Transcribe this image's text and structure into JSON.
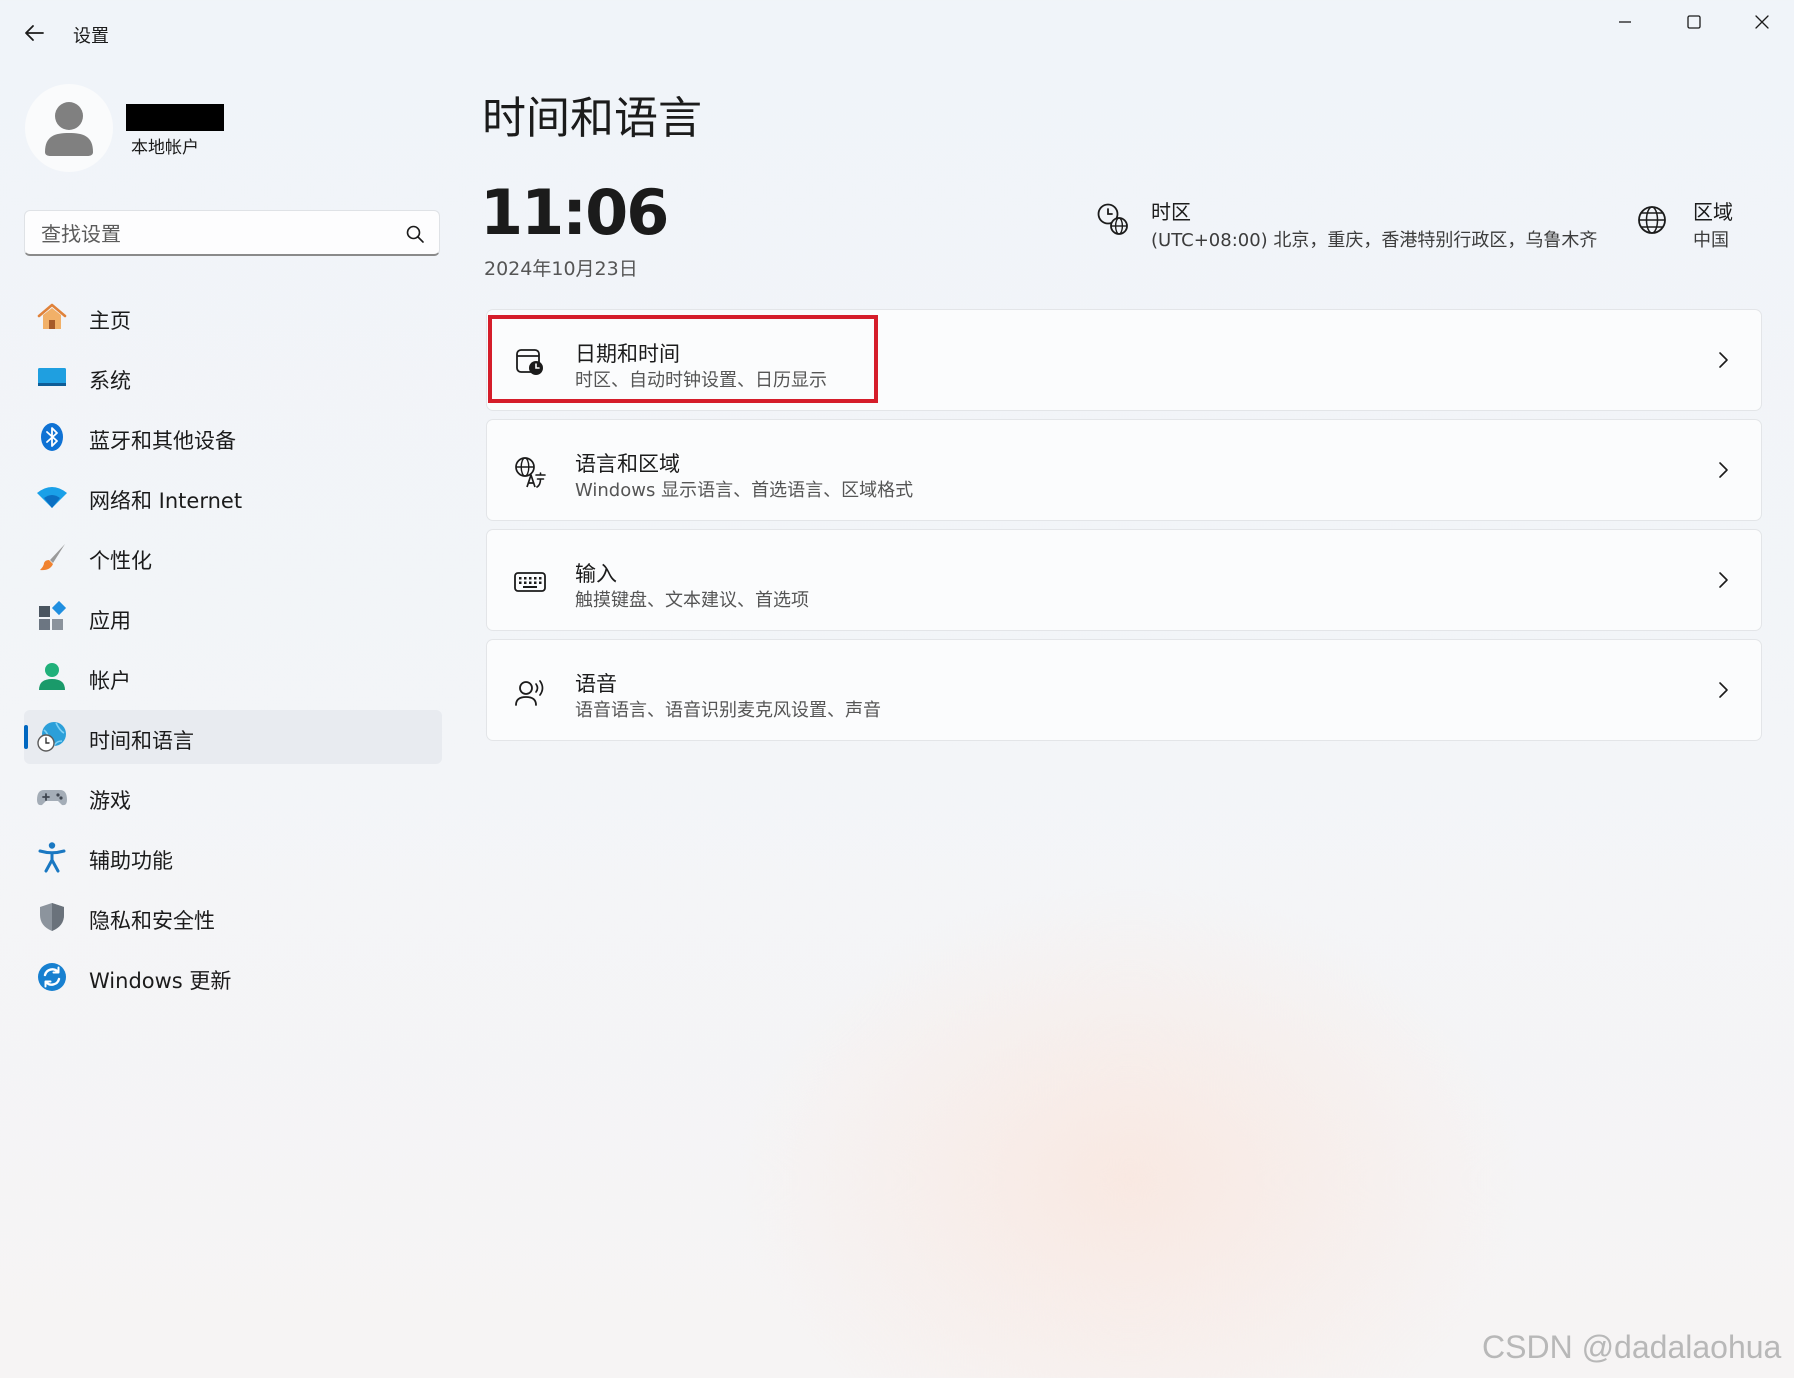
{
  "window": {
    "title": "设置"
  },
  "account": {
    "type_label": "本地帐户"
  },
  "search": {
    "placeholder": "查找设置"
  },
  "nav": {
    "items": [
      {
        "label": "主页",
        "icon": "home-icon"
      },
      {
        "label": "系统",
        "icon": "system-monitor-icon"
      },
      {
        "label": "蓝牙和其他设备",
        "icon": "bluetooth-icon"
      },
      {
        "label": "网络和 Internet",
        "icon": "wifi-icon"
      },
      {
        "label": "个性化",
        "icon": "paintbrush-icon"
      },
      {
        "label": "应用",
        "icon": "apps-icon"
      },
      {
        "label": "帐户",
        "icon": "account-icon"
      },
      {
        "label": "时间和语言",
        "icon": "globe-clock-icon",
        "active": true
      },
      {
        "label": "游戏",
        "icon": "gamepad-icon"
      },
      {
        "label": "辅助功能",
        "icon": "accessibility-icon"
      },
      {
        "label": "隐私和安全性",
        "icon": "shield-icon"
      },
      {
        "label": "Windows 更新",
        "icon": "update-icon"
      }
    ]
  },
  "main": {
    "title": "时间和语言",
    "time": "11:06",
    "date": "2024年10月23日",
    "timezone": {
      "title": "时区",
      "value": "(UTC+08:00) 北京，重庆，香港特别行政区，乌鲁木齐"
    },
    "region": {
      "title": "区域",
      "value": "中国"
    },
    "cards": [
      {
        "title": "日期和时间",
        "subtitle": "时区、自动时钟设置、日历显示",
        "icon": "calendar-clock-icon",
        "highlighted": true
      },
      {
        "title": "语言和区域",
        "subtitle": "Windows 显示语言、首选语言、区域格式",
        "icon": "language-icon"
      },
      {
        "title": "输入",
        "subtitle": "触摸键盘、文本建议、首选项",
        "icon": "keyboard-icon"
      },
      {
        "title": "语音",
        "subtitle": "语音语言、语音识别麦克风设置、声音",
        "icon": "speech-icon"
      }
    ]
  },
  "watermark": "CSDN @dadalaohua",
  "colors": {
    "accent": "#0067c0",
    "highlight": "#d51d2a"
  }
}
